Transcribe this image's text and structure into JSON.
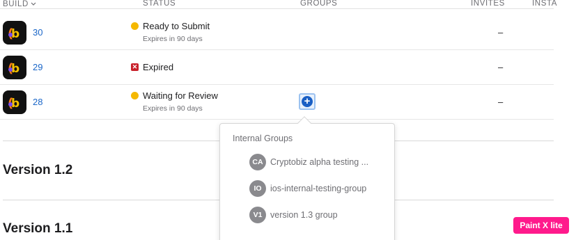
{
  "header": {
    "build": "BUILD",
    "status": "STATUS",
    "groups": "GROUPS",
    "invites": "INVITES",
    "installs": "INSTA"
  },
  "builds": [
    {
      "number": "30",
      "status": "Ready to Submit",
      "sub": "Expires in 90 days",
      "status_type": "warning",
      "invites": "–"
    },
    {
      "number": "29",
      "status": "Expired",
      "sub": "",
      "status_type": "expired",
      "invites": "–"
    },
    {
      "number": "28",
      "status": "Waiting for Review",
      "sub": "Expires in 90 days",
      "status_type": "warning",
      "invites": "–"
    }
  ],
  "add_group_button": "+",
  "popover": {
    "title": "Internal Groups",
    "groups": [
      {
        "initials": "CA",
        "label": "Cryptobiz alpha testing ..."
      },
      {
        "initials": "IO",
        "label": "ios-internal-testing-group"
      },
      {
        "initials": "V1",
        "label": "version 1.3 group"
      }
    ]
  },
  "versions": [
    {
      "title": "Version 1.2"
    },
    {
      "title": "Version 1.1"
    }
  ],
  "watermark": "Paint X lite",
  "colors": {
    "link": "#1a66c8",
    "warning": "#f5b800",
    "expired": "#c8202a",
    "accent": "#1a5fc4",
    "watermark": "#ff1a8c"
  }
}
